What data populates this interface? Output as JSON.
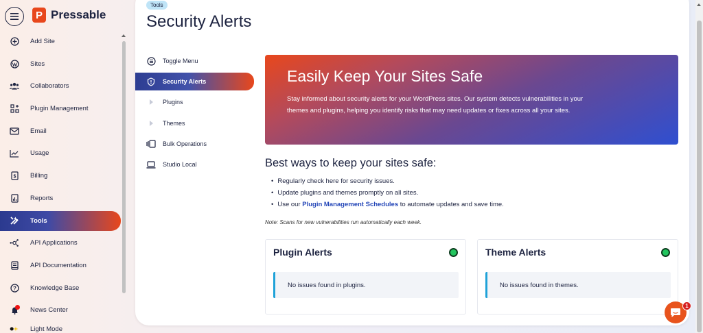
{
  "app": {
    "brand": "Pressable",
    "brand_mark": "P",
    "brand_color": "#e8471c",
    "accent_gradient": [
      "#2b3a8f",
      "#e8471c"
    ]
  },
  "sidebar": {
    "items": [
      {
        "label": "Add Site",
        "icon": "plus-circle-icon"
      },
      {
        "label": "Sites",
        "icon": "wordpress-icon"
      },
      {
        "label": "Collaborators",
        "icon": "users-icon"
      },
      {
        "label": "Plugin Management",
        "icon": "plugin-grid-icon"
      },
      {
        "label": "Email",
        "icon": "envelope-icon"
      },
      {
        "label": "Usage",
        "icon": "chart-line-icon"
      },
      {
        "label": "Billing",
        "icon": "invoice-icon"
      },
      {
        "label": "Reports",
        "icon": "report-icon"
      },
      {
        "label": "Tools",
        "icon": "tools-icon",
        "active": true
      },
      {
        "label": "API Applications",
        "icon": "api-nodes-icon"
      },
      {
        "label": "API Documentation",
        "icon": "book-icon"
      },
      {
        "label": "Knowledge Base",
        "icon": "question-circle-icon"
      },
      {
        "label": "News Center",
        "icon": "bell-icon"
      },
      {
        "label": "Light Mode",
        "icon": "theme-toggle-icon"
      }
    ]
  },
  "header": {
    "breadcrumb": "Tools",
    "title": "Security Alerts"
  },
  "subnav": {
    "items": [
      {
        "label": "Toggle Menu",
        "icon": "menu-circle-icon"
      },
      {
        "label": "Security Alerts",
        "icon": "shield-icon",
        "active": true
      },
      {
        "label": "Plugins",
        "icon": "caret-right-icon"
      },
      {
        "label": "Themes",
        "icon": "caret-right-icon"
      },
      {
        "label": "Bulk Operations",
        "icon": "bulk-icon"
      },
      {
        "label": "Studio Local",
        "icon": "laptop-icon"
      }
    ]
  },
  "hero": {
    "title": "Easily Keep Your Sites Safe",
    "body": "Stay informed about security alerts for your WordPress sites. Our system detects vulnerabilities in your themes and plugins, helping you identify risks that may need updates or fixes across all your sites."
  },
  "tips": {
    "title": "Best ways to keep your sites safe:",
    "item1": "Regularly check here for security issues.",
    "item2": "Update plugins and themes promptly on all sites.",
    "item3_pre": "Use our ",
    "item3_link": "Plugin Management Schedules",
    "item3_post": " to automate updates and save time.",
    "note": "Note: Scans for new vulnerabilities run automatically each week."
  },
  "cards": {
    "plugin": {
      "title": "Plugin Alerts",
      "message": "No issues found in plugins.",
      "status_color": "#22c55e"
    },
    "theme": {
      "title": "Theme Alerts",
      "message": "No issues found in themes.",
      "status_color": "#22c55e"
    }
  },
  "chat": {
    "badge": "1"
  }
}
